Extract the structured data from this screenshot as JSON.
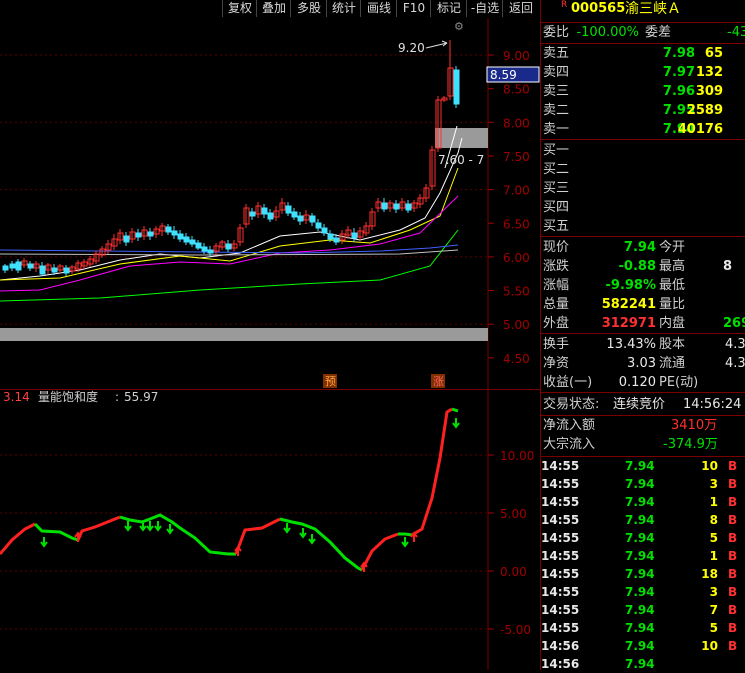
{
  "toolbar": {
    "buttons": [
      "复权",
      "叠加",
      "多股",
      "统计",
      "画线",
      "F10",
      "标记",
      "-自选",
      "返回"
    ],
    "settings_label": "⚙"
  },
  "price_chart": {
    "y_ticks": [
      "9.00",
      "8.50",
      "8.00",
      "7.50",
      "7.00",
      "6.50",
      "6.00",
      "5.50",
      "5.00",
      "4.50"
    ],
    "cursor_price": "8.59",
    "high_label": "9.20",
    "range_label": "7.60 - 7",
    "markers": [
      "预",
      "涨"
    ]
  },
  "indicator": {
    "name": "量能饱和度",
    "value_label": "55.97",
    "left_value": "3.14",
    "y_ticks": [
      "10.00",
      "5.00",
      "0.00",
      "-5.00"
    ]
  },
  "quote": {
    "code": "000565",
    "name": "渝三峡Ａ",
    "badge": "R",
    "weibi_label": "委比",
    "weibi_value": "-100.00%",
    "weicha_label": "委差",
    "weicha_value": "-43",
    "sell": [
      {
        "label": "卖五",
        "price": "7.98",
        "vol": "65"
      },
      {
        "label": "卖四",
        "price": "7.97",
        "vol": "132"
      },
      {
        "label": "卖三",
        "price": "7.96",
        "vol": "309"
      },
      {
        "label": "卖二",
        "price": "7.95",
        "vol": "2589"
      },
      {
        "label": "卖一",
        "price": "7.94",
        "vol": "40176"
      }
    ],
    "buy": [
      "买一",
      "买二",
      "买三",
      "买四",
      "买五"
    ],
    "stats": [
      {
        "l": "现价",
        "v": "7.94",
        "l2": "今开",
        "v2": ""
      },
      {
        "l": "涨跌",
        "v": "-0.88",
        "l2": "最高",
        "v2": "8"
      },
      {
        "l": "涨幅",
        "v": "-9.98%",
        "l2": "最低",
        "v2": ""
      },
      {
        "l": "总量",
        "v": "582241",
        "l2": "量比",
        "v2": ""
      },
      {
        "l": "外盘",
        "v": "312971",
        "l2": "内盘",
        "v2": "269"
      }
    ],
    "stats2": [
      {
        "l": "换手",
        "v": "13.43%",
        "l2": "股本",
        "v2": "4.3"
      },
      {
        "l": "净资",
        "v": "3.03",
        "l2": "流通",
        "v2": "4.3"
      },
      {
        "l": "收益(一)",
        "v": "0.120",
        "l2": "PE(动)",
        "v2": ""
      }
    ],
    "trade_status_label": "交易状态:",
    "trade_status": "连续竞价",
    "trade_time": "14:56:24",
    "net_inflow_label": "净流入额",
    "net_inflow": "3410万",
    "block_inflow_label": "大宗流入",
    "block_inflow": "-374.9万",
    "ticks": [
      {
        "t": "14:55",
        "p": "7.94",
        "v": "10",
        "d": "B"
      },
      {
        "t": "14:55",
        "p": "7.94",
        "v": "3",
        "d": "B"
      },
      {
        "t": "14:55",
        "p": "7.94",
        "v": "1",
        "d": "B"
      },
      {
        "t": "14:55",
        "p": "7.94",
        "v": "8",
        "d": "B"
      },
      {
        "t": "14:55",
        "p": "7.94",
        "v": "5",
        "d": "B"
      },
      {
        "t": "14:55",
        "p": "7.94",
        "v": "1",
        "d": "B"
      },
      {
        "t": "14:55",
        "p": "7.94",
        "v": "18",
        "d": "B"
      },
      {
        "t": "14:55",
        "p": "7.94",
        "v": "3",
        "d": "B"
      },
      {
        "t": "14:55",
        "p": "7.94",
        "v": "7",
        "d": "B"
      },
      {
        "t": "14:55",
        "p": "7.94",
        "v": "5",
        "d": "B"
      },
      {
        "t": "14:56",
        "p": "7.94",
        "v": "10",
        "d": "B"
      },
      {
        "t": "14:56",
        "p": "7.94",
        "v": "",
        "d": ""
      }
    ]
  }
}
